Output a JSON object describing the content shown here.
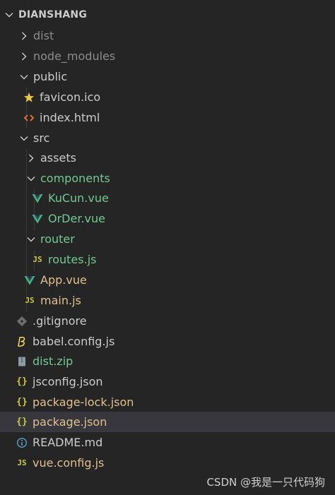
{
  "explorer": {
    "section_title": "DIANSHANG",
    "items": [
      {
        "name": "dist",
        "kind": "folder",
        "expanded": false
      },
      {
        "name": "node_modules",
        "kind": "folder",
        "expanded": false
      },
      {
        "name": "public",
        "kind": "folder",
        "expanded": true
      },
      {
        "name": "favicon.ico",
        "kind": "file",
        "icon": "star-icon"
      },
      {
        "name": "index.html",
        "kind": "file",
        "icon": "html-icon"
      },
      {
        "name": "src",
        "kind": "folder",
        "expanded": true
      },
      {
        "name": "assets",
        "kind": "folder",
        "expanded": false
      },
      {
        "name": "components",
        "kind": "folder",
        "expanded": true
      },
      {
        "name": "KuCun.vue",
        "kind": "file",
        "icon": "vue-icon"
      },
      {
        "name": "OrDer.vue",
        "kind": "file",
        "icon": "vue-icon"
      },
      {
        "name": "router",
        "kind": "folder",
        "expanded": true
      },
      {
        "name": "routes.js",
        "kind": "file",
        "icon": "js-icon"
      },
      {
        "name": "App.vue",
        "kind": "file",
        "icon": "vue-icon"
      },
      {
        "name": "main.js",
        "kind": "file",
        "icon": "js-icon"
      },
      {
        "name": ".gitignore",
        "kind": "file",
        "icon": "git-icon"
      },
      {
        "name": "babel.config.js",
        "kind": "file",
        "icon": "babel-icon"
      },
      {
        "name": "dist.zip",
        "kind": "file",
        "icon": "zip-icon"
      },
      {
        "name": "jsconfig.json",
        "kind": "file",
        "icon": "json-icon"
      },
      {
        "name": "package-lock.json",
        "kind": "file",
        "icon": "json-icon"
      },
      {
        "name": "package.json",
        "kind": "file",
        "icon": "json-icon",
        "selected": true
      },
      {
        "name": "README.md",
        "kind": "file",
        "icon": "info-icon"
      },
      {
        "name": "vue.config.js",
        "kind": "file",
        "icon": "js-icon"
      }
    ],
    "js_badge": "JS",
    "json_badge": "{}"
  },
  "watermark": "CSDN @我是一只代码狗",
  "colors": {
    "background": "#252526",
    "selected_row": "#37373d",
    "text": "#cccccc",
    "dim_text": "#8c8c8c",
    "modified_green": "#73c991",
    "vue_green": "#41b883",
    "js_yellow": "#cbcb41",
    "html_orange": "#e37933"
  }
}
